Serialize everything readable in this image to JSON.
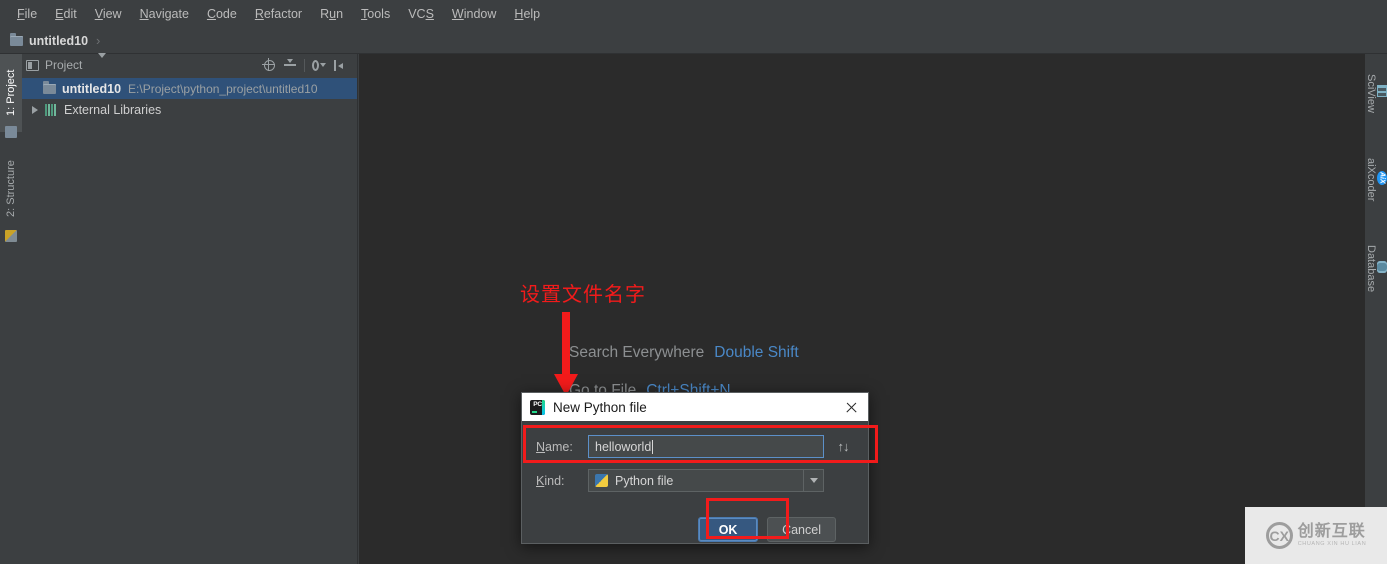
{
  "app": {
    "window_title": "untitled10",
    "theme_bg": "#3c3f41",
    "editor_bg": "#2b2b2b",
    "accent": "#4a88c7",
    "annotation_color": "#f21b1b"
  },
  "menubar": {
    "items": [
      {
        "label": "File",
        "mnemonic": "F",
        "rest": "ile"
      },
      {
        "label": "Edit",
        "mnemonic": "E",
        "rest": "dit"
      },
      {
        "label": "View",
        "mnemonic": "V",
        "rest": "iew"
      },
      {
        "label": "Navigate",
        "mnemonic": "N",
        "rest": "avigate"
      },
      {
        "label": "Code",
        "mnemonic": "C",
        "rest": "ode"
      },
      {
        "label": "Refactor",
        "mnemonic": "R",
        "rest": "efactor"
      },
      {
        "label": "Run",
        "pre": "R",
        "mnemonic": "u",
        "rest": "n"
      },
      {
        "label": "Tools",
        "mnemonic": "T",
        "rest": "ools"
      },
      {
        "label": "VCS",
        "pre": "VC",
        "mnemonic": "S",
        "rest": ""
      },
      {
        "label": "Window",
        "mnemonic": "W",
        "rest": "indow"
      },
      {
        "label": "Help",
        "mnemonic": "H",
        "rest": "elp"
      }
    ]
  },
  "navbar": {
    "project_name": "untitled10",
    "folder_icon": "folder-icon"
  },
  "toolbar": {
    "run_config_value": "",
    "buttons": [
      {
        "name": "run-button",
        "icon": "play-icon"
      },
      {
        "name": "debug-button",
        "icon": "bug-icon"
      },
      {
        "name": "coverage-button",
        "icon": "coverage-icon"
      },
      {
        "name": "profile-button",
        "icon": "profile-icon"
      },
      {
        "name": "more-run-button",
        "icon": "list-icon"
      },
      {
        "name": "stop-button",
        "icon": "stop-icon"
      },
      {
        "name": "search-everywhere-button",
        "icon": "search-icon"
      }
    ]
  },
  "left_strip": {
    "tabs": [
      {
        "label": "1: Project",
        "icon": "project-icon",
        "active": true
      },
      {
        "label": "2: Structure",
        "icon": "structure-icon",
        "active": false
      }
    ]
  },
  "right_strip": {
    "tabs": [
      {
        "label": "SciView",
        "icon": "grid-icon"
      },
      {
        "label": "aiXcoder",
        "icon": "aixcoder-icon",
        "glyph": "AiX"
      },
      {
        "label": "Database",
        "icon": "database-icon"
      }
    ]
  },
  "project_pane": {
    "title": "Project",
    "actions": [
      {
        "name": "locate-file-button",
        "icon": "crosshair-icon"
      },
      {
        "name": "collapse-all-button",
        "icon": "collapse-all-icon"
      },
      {
        "name": "settings-button",
        "icon": "gear-icon"
      },
      {
        "name": "hide-button",
        "icon": "hide-icon"
      }
    ],
    "tree": [
      {
        "name": "untitled10",
        "path": "E:\\Project\\python_project\\untitled10",
        "selected": true,
        "icon": "folder-icon",
        "expandable": false
      },
      {
        "name": "External Libraries",
        "path": "",
        "selected": false,
        "icon": "library-icon",
        "expandable": true
      }
    ]
  },
  "editor_hints": [
    {
      "text": "Search Everywhere",
      "key": "Double Shift"
    },
    {
      "text": "Go to File",
      "key": "Ctrl+Shift+N"
    }
  ],
  "annotation": {
    "text": "设置文件名字",
    "arrow": "down-arrow",
    "boxes": [
      "name-field-highlight",
      "ok-button-highlight"
    ]
  },
  "dialog": {
    "title": "New Python file",
    "icon": "pycharm-icon",
    "icon_glyph": "PC",
    "close_icon": "close-icon",
    "name_label": "Name:",
    "name_mnemonic": "N",
    "name_label_rest": "ame:",
    "name_value": "helloworld",
    "name_placeholder": "",
    "history_arrows": "↑↓",
    "kind_label": "Kind:",
    "kind_mnemonic": "K",
    "kind_label_rest": "ind:",
    "kind_value": "Python file",
    "kind_icon": "python-file-icon",
    "ok_label": "OK",
    "cancel_label": "Cancel"
  },
  "watermark": {
    "logo_glyph": "CX",
    "cn_text": "创新互联",
    "en_text": "CHUANG XIN HU LIAN"
  }
}
